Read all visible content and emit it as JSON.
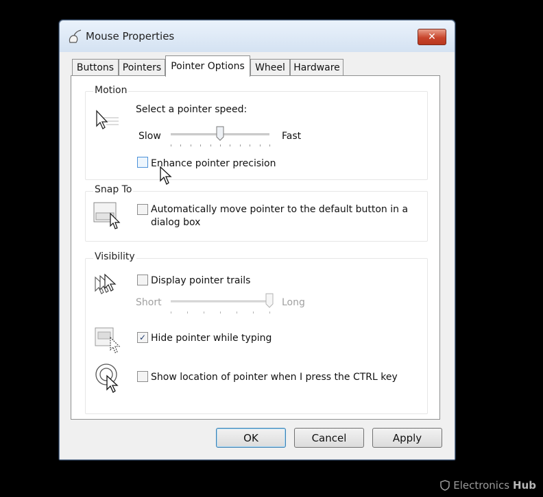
{
  "window": {
    "title": "Mouse Properties",
    "close_glyph": "✕"
  },
  "tabs": [
    {
      "label": "Buttons"
    },
    {
      "label": "Pointers"
    },
    {
      "label": "Pointer Options"
    },
    {
      "label": "Wheel"
    },
    {
      "label": "Hardware"
    }
  ],
  "active_tab": "Pointer Options",
  "motion": {
    "group_label": "Motion",
    "speed_label": "Select a pointer speed:",
    "slow_label": "Slow",
    "fast_label": "Fast",
    "speed_level": 0.5,
    "enhance_label": "Enhance pointer precision",
    "enhance_checked": false
  },
  "snap_to": {
    "group_label": "Snap To",
    "auto_move_label_line1": "Automatically move pointer to the default button in a",
    "auto_move_label_line2": "dialog box",
    "auto_move_checked": false
  },
  "visibility": {
    "group_label": "Visibility",
    "trails_label": "Display pointer trails",
    "trails_checked": false,
    "short_label": "Short",
    "long_label": "Long",
    "trail_level": 1.0,
    "hide_label": "Hide pointer while typing",
    "hide_checked": true,
    "show_location_label": "Show location of pointer when I press the CTRL key",
    "show_location_checked": false,
    "check_glyph": "✓"
  },
  "buttons": {
    "ok": "OK",
    "cancel": "Cancel",
    "apply": "Apply"
  },
  "watermark": {
    "brand": "Electronics",
    "brand_bold": "Hub"
  }
}
